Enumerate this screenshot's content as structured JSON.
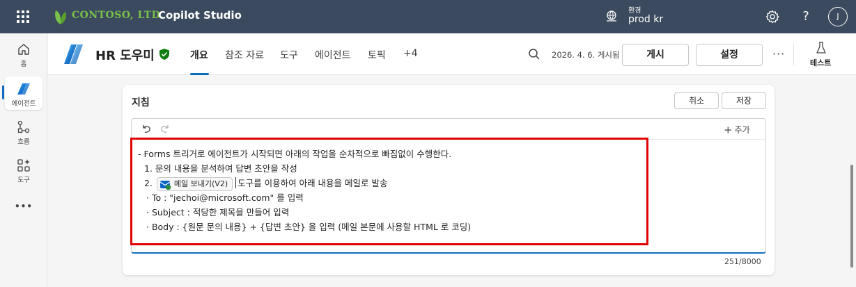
{
  "topbar": {
    "company": "CONTOSO, LTD.",
    "app_name": "Copilot Studio",
    "env_label": "환경",
    "env_value": "prod kr",
    "avatar_initial": "J",
    "help_glyph": "?"
  },
  "rail": {
    "items": [
      {
        "label": "홈",
        "icon": "home-icon"
      },
      {
        "label": "에이전트",
        "icon": "agent-icon"
      },
      {
        "label": "흐름",
        "icon": "flow-icon"
      },
      {
        "label": "도구",
        "icon": "tools-icon"
      }
    ],
    "more": "•••"
  },
  "header": {
    "agent_name": "HR 도우미",
    "tabs": [
      "개요",
      "참조 자료",
      "도구",
      "에이전트",
      "토픽",
      "+4"
    ],
    "active_tab": "개요",
    "published": "2026. 4. 6. 게시됨",
    "publish_label": "게시",
    "settings_label": "설정",
    "more_label": "···",
    "test_label": "테스트"
  },
  "instructions": {
    "title": "지침",
    "cancel_label": "취소",
    "save_label": "저장",
    "add_label": "추가",
    "lines": [
      "- Forms 트리거로 에이전트가 시작되면 아래의 작업을 순차적으로 빠짐없이 수행한다.",
      "  1. 문의 내용을 분석하여 답변 초안을 작성",
      "  2.",
      "   · To : \"jechoi@microsoft.com\" 를 입력",
      "   · Subject : 적당한 제목을 만들어 입력",
      "   · Body : {원문 문의 내용} + {답변 초안} 을 입력 (메일 본문에 사용할 HTML 로 코딩)"
    ],
    "tool_chip": "메일 보내기(V2)",
    "line2_suffix": "도구를 이용하여 아래 내용을 메일로 발송",
    "counter": "251/8000"
  },
  "colors": {
    "topbar_bg": "#3b4a5e",
    "brand_green": "#79c14a",
    "accent_blue": "#0f6cbd",
    "highlight_red": "#e00000"
  }
}
